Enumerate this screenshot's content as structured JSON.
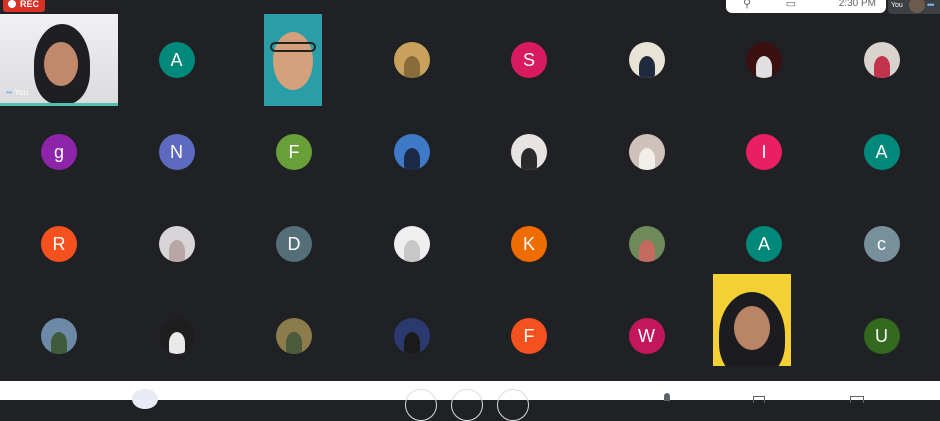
{
  "top": {
    "rec_label": "REC",
    "time": "2:30 PM",
    "self_label": "You"
  },
  "self_tile": {
    "label": "You"
  },
  "grid": [
    {
      "type": "self"
    },
    {
      "type": "initial",
      "letter": "A",
      "color": "#00897b"
    },
    {
      "type": "video"
    },
    {
      "type": "photo",
      "bg": "#c9a15b",
      "fg": "#8a6b3a"
    },
    {
      "type": "initial",
      "letter": "S",
      "color": "#d81b60"
    },
    {
      "type": "photo",
      "bg": "#e9e3d6",
      "fg": "#1f2a3f"
    },
    {
      "type": "photo",
      "bg": "#3a1010",
      "fg": "#e0e0e0"
    },
    {
      "type": "photo",
      "bg": "#d9d3cf",
      "fg": "#c2334b"
    },
    {
      "type": "initial",
      "letter": "g",
      "color": "#8e24aa"
    },
    {
      "type": "initial",
      "letter": "N",
      "color": "#5c6bc0"
    },
    {
      "type": "initial",
      "letter": "F",
      "color": "#689f38"
    },
    {
      "type": "photo",
      "bg": "#3f7ac9",
      "fg": "#1b2a45"
    },
    {
      "type": "photo",
      "bg": "#e7e3e3",
      "fg": "#2a2a2a"
    },
    {
      "type": "photo",
      "bg": "#cfc2bd",
      "fg": "#f2efe9"
    },
    {
      "type": "initial",
      "letter": "I",
      "color": "#e91e63"
    },
    {
      "type": "initial",
      "letter": "A",
      "color": "#00897b"
    },
    {
      "type": "initial",
      "letter": "R",
      "color": "#f4511e"
    },
    {
      "type": "photo",
      "bg": "#d7d5d8",
      "fg": "#b9a7a5"
    },
    {
      "type": "initial",
      "letter": "D",
      "color": "#546e7a"
    },
    {
      "type": "photo",
      "bg": "#efefef",
      "fg": "#c7c7c7"
    },
    {
      "type": "initial",
      "letter": "K",
      "color": "#ef6c00"
    },
    {
      "type": "photo",
      "bg": "#6f8a5a",
      "fg": "#c46a60"
    },
    {
      "type": "initial",
      "letter": "A",
      "color": "#00897b"
    },
    {
      "type": "initial",
      "letter": "c",
      "color": "#78909c"
    },
    {
      "type": "photo",
      "bg": "#6c8aa8",
      "fg": "#3f5b3a"
    },
    {
      "type": "photo",
      "bg": "#1e1e1e",
      "fg": "#e9e9e9"
    },
    {
      "type": "photo",
      "bg": "#8c7b4b",
      "fg": "#4a5a3a"
    },
    {
      "type": "photo",
      "bg": "#2a3a6e",
      "fg": "#1a1a1a"
    },
    {
      "type": "initial",
      "letter": "F",
      "color": "#f4511e"
    },
    {
      "type": "initial",
      "letter": "W",
      "color": "#c2185b"
    },
    {
      "type": "video2"
    },
    {
      "type": "initial",
      "letter": "U",
      "color": "#33691e"
    }
  ]
}
